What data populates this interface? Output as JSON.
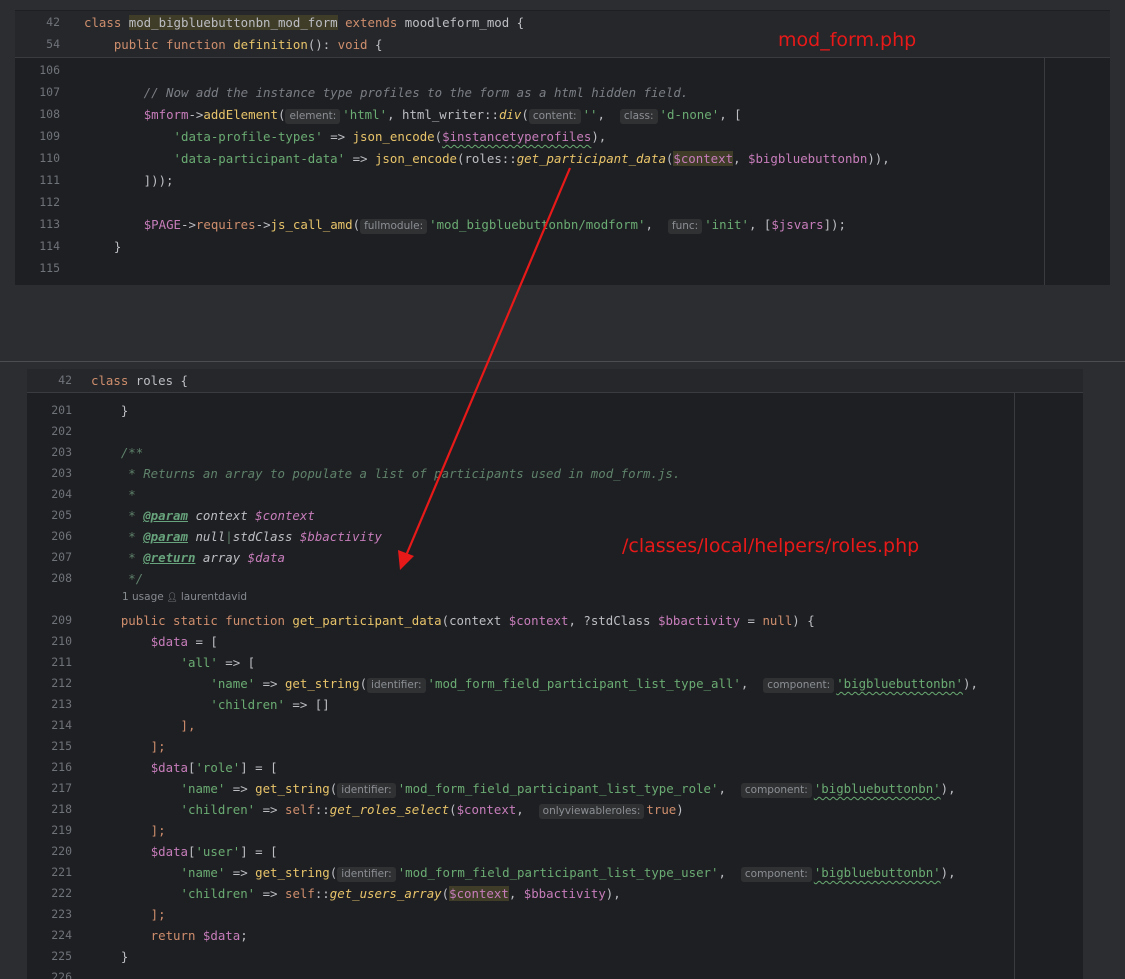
{
  "top_pane": {
    "sticky": [
      {
        "num": "42",
        "parts": [
          {
            "t": "class ",
            "c": "kw"
          },
          {
            "t": "mod_bigbluebuttonbn_mod_form",
            "c": "cls hl"
          },
          {
            "t": " extends ",
            "c": "kw"
          },
          {
            "t": "moodleform_mod {",
            "c": "cls"
          }
        ]
      },
      {
        "num": "54",
        "parts": [
          {
            "t": "    public function ",
            "c": "kw"
          },
          {
            "t": "definition",
            "c": "fny"
          },
          {
            "t": "(): ",
            "c": "cls"
          },
          {
            "t": "void",
            "c": "kw"
          },
          {
            "t": " {",
            "c": "cls"
          }
        ]
      }
    ],
    "lines": [
      {
        "num": "106",
        "parts": []
      },
      {
        "num": "107",
        "parts": [
          {
            "t": "        // Now add the instance type profiles to the form as a html hidden field.",
            "c": "cmt"
          }
        ]
      },
      {
        "num": "108",
        "parts": [
          {
            "t": "        ",
            "c": "cls"
          },
          {
            "t": "$mform",
            "c": "var"
          },
          {
            "t": "->",
            "c": "cls"
          },
          {
            "t": "addElement",
            "c": "fny"
          },
          {
            "t": "(",
            "c": "cls"
          },
          {
            "hint": "element:"
          },
          {
            "t": "'html'",
            "c": "str"
          },
          {
            "t": ", html_writer::",
            "c": "cls"
          },
          {
            "t": "div",
            "c": "fny ital"
          },
          {
            "t": "(",
            "c": "cls"
          },
          {
            "hint": "content:"
          },
          {
            "t": "''",
            "c": "str"
          },
          {
            "t": ",  ",
            "c": "cls"
          },
          {
            "hint": "class:"
          },
          {
            "t": "'d-none'",
            "c": "str"
          },
          {
            "t": ", [",
            "c": "cls"
          }
        ]
      },
      {
        "num": "109",
        "parts": [
          {
            "t": "            ",
            "c": "cls"
          },
          {
            "t": "'data-profile-types'",
            "c": "str"
          },
          {
            "t": " => ",
            "c": "cls"
          },
          {
            "t": "json_encode",
            "c": "fny"
          },
          {
            "t": "(",
            "c": "cls"
          },
          {
            "t": "$instancetyperofiles",
            "c": "var und"
          },
          {
            "t": "),",
            "c": "cls"
          }
        ]
      },
      {
        "num": "110",
        "parts": [
          {
            "t": "            ",
            "c": "cls"
          },
          {
            "t": "'data-participant-data'",
            "c": "str"
          },
          {
            "t": " => ",
            "c": "cls"
          },
          {
            "t": "json_encode",
            "c": "fny"
          },
          {
            "t": "(roles::",
            "c": "cls"
          },
          {
            "t": "get_participant_data",
            "c": "fny ital"
          },
          {
            "t": "(",
            "c": "cls"
          },
          {
            "t": "$context",
            "c": "var hl"
          },
          {
            "t": ", ",
            "c": "cls"
          },
          {
            "t": "$bigbluebuttonbn",
            "c": "var"
          },
          {
            "t": ")),",
            "c": "cls"
          }
        ]
      },
      {
        "num": "111",
        "parts": [
          {
            "t": "        ]));",
            "c": "cls"
          }
        ]
      },
      {
        "num": "112",
        "parts": []
      },
      {
        "num": "113",
        "parts": [
          {
            "t": "        ",
            "c": "cls"
          },
          {
            "t": "$PAGE",
            "c": "var"
          },
          {
            "t": "->",
            "c": "cls"
          },
          {
            "t": "requires",
            "c": "kw"
          },
          {
            "t": "->",
            "c": "cls"
          },
          {
            "t": "js_call_amd",
            "c": "fny"
          },
          {
            "t": "(",
            "c": "cls"
          },
          {
            "hint": "fullmodule:"
          },
          {
            "t": "'mod_bigbluebuttonbn/modform'",
            "c": "str"
          },
          {
            "t": ",  ",
            "c": "cls"
          },
          {
            "hint": "func:"
          },
          {
            "t": "'init'",
            "c": "str"
          },
          {
            "t": ", [",
            "c": "cls"
          },
          {
            "t": "$jsvars",
            "c": "var"
          },
          {
            "t": "]);",
            "c": "cls"
          }
        ]
      },
      {
        "num": "114",
        "parts": [
          {
            "t": "    }",
            "c": "cls"
          }
        ]
      },
      {
        "num": "115",
        "parts": []
      }
    ]
  },
  "bottom_pane": {
    "sticky": [
      {
        "num": "42",
        "parts": [
          {
            "t": "class ",
            "c": "kw"
          },
          {
            "t": "roles {",
            "c": "cls"
          }
        ]
      }
    ],
    "lines": [
      {
        "num": "201",
        "parts": [
          {
            "t": "    }",
            "c": "cls"
          }
        ]
      },
      {
        "num": "202",
        "parts": []
      },
      {
        "num": "203",
        "parts": [
          {
            "t": "    /**",
            "c": "doc"
          }
        ]
      },
      {
        "num": "203",
        "parts": [
          {
            "t": "     * Returns an array to populate a list of participants used in mod_form.js.",
            "c": "doc"
          }
        ]
      },
      {
        "num": "204",
        "parts": [
          {
            "t": "     *",
            "c": "doc"
          }
        ]
      },
      {
        "num": "205",
        "parts": [
          {
            "t": "     * ",
            "c": "doc"
          },
          {
            "t": "@param",
            "c": "tag"
          },
          {
            "t": " context ",
            "c": "cls ital"
          },
          {
            "t": "$context",
            "c": "var ital"
          }
        ]
      },
      {
        "num": "206",
        "parts": [
          {
            "t": "     * ",
            "c": "doc"
          },
          {
            "t": "@param",
            "c": "tag"
          },
          {
            "t": " null",
            "c": "cls ital"
          },
          {
            "t": "|",
            "c": "doc"
          },
          {
            "t": "stdClass ",
            "c": "cls ital"
          },
          {
            "t": "$bbactivity",
            "c": "var ital"
          }
        ]
      },
      {
        "num": "207",
        "parts": [
          {
            "t": "     * ",
            "c": "doc"
          },
          {
            "t": "@return",
            "c": "tag"
          },
          {
            "t": " array ",
            "c": "cls ital"
          },
          {
            "t": "$data",
            "c": "var ital"
          }
        ]
      },
      {
        "num": "208",
        "parts": [
          {
            "t": "     */",
            "c": "doc"
          }
        ]
      }
    ],
    "usage": {
      "count": "1 usage",
      "author": "laurentdavid"
    },
    "lines2": [
      {
        "num": "209",
        "parts": [
          {
            "t": "    public static function ",
            "c": "kw"
          },
          {
            "t": "get_participant_data",
            "c": "fny"
          },
          {
            "t": "(context ",
            "c": "cls"
          },
          {
            "t": "$context",
            "c": "var"
          },
          {
            "t": ", ?stdClass ",
            "c": "cls"
          },
          {
            "t": "$bbactivity",
            "c": "var"
          },
          {
            "t": " = ",
            "c": "cls"
          },
          {
            "t": "null",
            "c": "kw"
          },
          {
            "t": ") {",
            "c": "cls"
          }
        ]
      },
      {
        "num": "210",
        "parts": [
          {
            "t": "        ",
            "c": "cls"
          },
          {
            "t": "$data",
            "c": "var"
          },
          {
            "t": " = [",
            "c": "cls"
          }
        ]
      },
      {
        "num": "211",
        "parts": [
          {
            "t": "            ",
            "c": "cls"
          },
          {
            "t": "'all'",
            "c": "str"
          },
          {
            "t": " => [",
            "c": "cls"
          }
        ]
      },
      {
        "num": "212",
        "parts": [
          {
            "t": "                ",
            "c": "cls"
          },
          {
            "t": "'name'",
            "c": "str"
          },
          {
            "t": " => ",
            "c": "cls"
          },
          {
            "t": "get_string",
            "c": "fny"
          },
          {
            "t": "(",
            "c": "cls"
          },
          {
            "hint": "identifier:"
          },
          {
            "t": "'mod_form_field_participant_list_type_all'",
            "c": "str"
          },
          {
            "t": ",  ",
            "c": "cls"
          },
          {
            "hint": "component:"
          },
          {
            "t": "'bigbluebuttonbn'",
            "c": "str und"
          },
          {
            "t": "),",
            "c": "cls"
          }
        ]
      },
      {
        "num": "213",
        "parts": [
          {
            "t": "                ",
            "c": "cls"
          },
          {
            "t": "'children'",
            "c": "str"
          },
          {
            "t": " => []",
            "c": "cls"
          }
        ]
      },
      {
        "num": "214",
        "parts": [
          {
            "t": "            ],",
            "c": "kw"
          }
        ]
      },
      {
        "num": "215",
        "parts": [
          {
            "t": "        ];",
            "c": "kw"
          }
        ]
      },
      {
        "num": "216",
        "parts": [
          {
            "t": "        ",
            "c": "cls"
          },
          {
            "t": "$data",
            "c": "var"
          },
          {
            "t": "[",
            "c": "cls"
          },
          {
            "t": "'role'",
            "c": "str"
          },
          {
            "t": "] = [",
            "c": "cls"
          }
        ]
      },
      {
        "num": "217",
        "parts": [
          {
            "t": "            ",
            "c": "cls"
          },
          {
            "t": "'name'",
            "c": "str"
          },
          {
            "t": " => ",
            "c": "cls"
          },
          {
            "t": "get_string",
            "c": "fny"
          },
          {
            "t": "(",
            "c": "cls"
          },
          {
            "hint": "identifier:"
          },
          {
            "t": "'mod_form_field_participant_list_type_role'",
            "c": "str"
          },
          {
            "t": ",  ",
            "c": "cls"
          },
          {
            "hint": "component:"
          },
          {
            "t": "'bigbluebuttonbn'",
            "c": "str und"
          },
          {
            "t": "),",
            "c": "cls"
          }
        ]
      },
      {
        "num": "218",
        "parts": [
          {
            "t": "            ",
            "c": "cls"
          },
          {
            "t": "'children'",
            "c": "str"
          },
          {
            "t": " => ",
            "c": "cls"
          },
          {
            "t": "self",
            "c": "kw"
          },
          {
            "t": "::",
            "c": "cls"
          },
          {
            "t": "get_roles_select",
            "c": "fny ital"
          },
          {
            "t": "(",
            "c": "cls"
          },
          {
            "t": "$context",
            "c": "var"
          },
          {
            "t": ",  ",
            "c": "cls"
          },
          {
            "hint": "onlyviewableroles:"
          },
          {
            "t": "true",
            "c": "kw"
          },
          {
            "t": ")",
            "c": "cls"
          }
        ]
      },
      {
        "num": "219",
        "parts": [
          {
            "t": "        ];",
            "c": "kw"
          }
        ]
      },
      {
        "num": "220",
        "parts": [
          {
            "t": "        ",
            "c": "cls"
          },
          {
            "t": "$data",
            "c": "var"
          },
          {
            "t": "[",
            "c": "cls"
          },
          {
            "t": "'user'",
            "c": "str"
          },
          {
            "t": "] = [",
            "c": "cls"
          }
        ]
      },
      {
        "num": "221",
        "parts": [
          {
            "t": "            ",
            "c": "cls"
          },
          {
            "t": "'name'",
            "c": "str"
          },
          {
            "t": " => ",
            "c": "cls"
          },
          {
            "t": "get_string",
            "c": "fny"
          },
          {
            "t": "(",
            "c": "cls"
          },
          {
            "hint": "identifier:"
          },
          {
            "t": "'mod_form_field_participant_list_type_user'",
            "c": "str"
          },
          {
            "t": ",  ",
            "c": "cls"
          },
          {
            "hint": "component:"
          },
          {
            "t": "'bigbluebuttonbn'",
            "c": "str und"
          },
          {
            "t": "),",
            "c": "cls"
          }
        ]
      },
      {
        "num": "222",
        "parts": [
          {
            "t": "            ",
            "c": "cls"
          },
          {
            "t": "'children'",
            "c": "str"
          },
          {
            "t": " => ",
            "c": "cls"
          },
          {
            "t": "self",
            "c": "kw"
          },
          {
            "t": "::",
            "c": "cls"
          },
          {
            "t": "get_users_array",
            "c": "fny ital"
          },
          {
            "t": "(",
            "c": "cls"
          },
          {
            "t": "$context",
            "c": "var hl"
          },
          {
            "t": ", ",
            "c": "cls"
          },
          {
            "t": "$bbactivity",
            "c": "var"
          },
          {
            "t": "),",
            "c": "cls"
          }
        ]
      },
      {
        "num": "223",
        "parts": [
          {
            "t": "        ];",
            "c": "kw"
          }
        ]
      },
      {
        "num": "224",
        "parts": [
          {
            "t": "        return ",
            "c": "kw"
          },
          {
            "t": "$data",
            "c": "var"
          },
          {
            "t": ";",
            "c": "cls"
          }
        ]
      },
      {
        "num": "225",
        "parts": [
          {
            "t": "    }",
            "c": "cls"
          }
        ]
      },
      {
        "num": "226",
        "parts": []
      }
    ]
  },
  "annotations": {
    "top_file": "mod_form.php",
    "bottom_file": "/classes/local/helpers/roles.php"
  },
  "colors": {
    "arrow": "#e81919",
    "tab_indicator": "#3574f0"
  }
}
